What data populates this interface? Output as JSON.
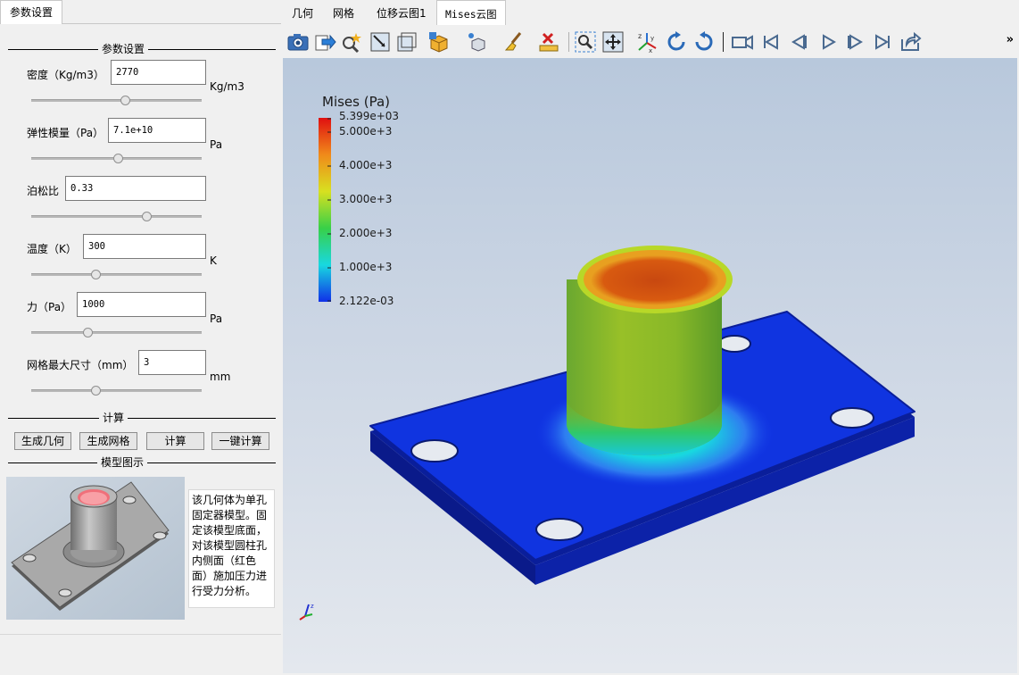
{
  "left": {
    "tab_label": "参数设置",
    "param_group_title": "参数设置",
    "params": [
      {
        "label": "密度（Kg/m3）",
        "value": "2770",
        "unit": "Kg/m3",
        "slider": 0.55
      },
      {
        "label": "弹性模量（Pa）",
        "value": "7.1e+10",
        "unit": "Pa",
        "slider": 0.5
      },
      {
        "label": "泊松比",
        "value": "0.33",
        "unit": "",
        "slider": 0.67
      },
      {
        "label": "温度（K）",
        "value": "300",
        "unit": "K",
        "slider": 0.37
      },
      {
        "label": "力（Pa）",
        "value": "1000",
        "unit": "Pa",
        "slider": 0.33
      },
      {
        "label": "网格最大尺寸（mm）",
        "value": "3",
        "unit": "mm",
        "slider": 0.37
      }
    ],
    "calc_group_title": "计算",
    "buttons": [
      "生成几何",
      "生成网格",
      "计算",
      "一键计算"
    ],
    "model_group_title": "模型图示",
    "model_description": "该几何体为单孔固定器模型。固定该模型底面，对该模型圆柱孔内侧面（红色面）施加压力进行受力分析。"
  },
  "right": {
    "tabs": [
      "几何",
      "网格",
      "位移云图1",
      "Mises云图"
    ],
    "active_tab_index": 3,
    "toolbar_icons": [
      "camera-icon",
      "export-icon",
      "zoom-select-icon",
      "frame-select-icon",
      "frame-icon",
      "cube-select-icon",
      "point-select-icon",
      "brush-icon",
      "clear-ruler-icon",
      "zoom-fit-icon",
      "zoom-extents-icon",
      "axes-icon",
      "rotate-cw-icon",
      "rotate-ccw-icon",
      "video-camera-icon",
      "first-frame-icon",
      "prev-frame-icon",
      "play-icon",
      "next-frame-icon",
      "last-frame-icon",
      "share-icon"
    ],
    "toolbar_more": "»",
    "legend": {
      "title": "Mises (Pa)",
      "max_label": "5.399e+03",
      "ticks": [
        "5.000e+3",
        "4.000e+3",
        "3.000e+3",
        "2.000e+3",
        "1.000e+3"
      ],
      "min_label": "2.122e-03",
      "colors": [
        "#e01010",
        "#f08a1a",
        "#d8e020",
        "#38d048",
        "#18d8e0",
        "#1030e8"
      ]
    },
    "axis_labels": [
      "z",
      "y",
      "x"
    ]
  }
}
